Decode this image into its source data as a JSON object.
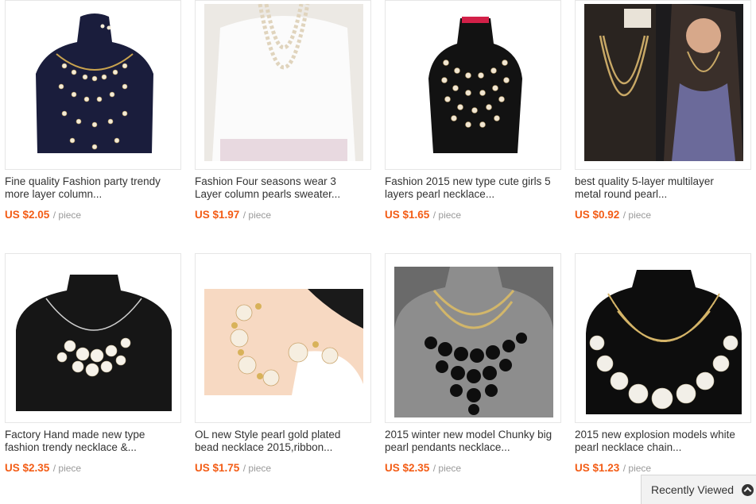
{
  "products": [
    {
      "title_line1": "Fine quality Fashion party trendy",
      "title_line2": "more layer column...",
      "price": "US $2.05",
      "unit": "/ piece",
      "image": "pearl-multilayer-necklace-on-black-bust"
    },
    {
      "title_line1": "Fashion Four seasons wear 3",
      "title_line2": "Layer column pearls sweater...",
      "price": "US $1.97",
      "unit": "/ piece",
      "image": "pearl-necklace-worn-on-white-dress"
    },
    {
      "title_line1": "Fashion 2015 new type cute girls 5",
      "title_line2": "layers pearl necklace...",
      "price": "US $1.65",
      "unit": "/ piece",
      "image": "five-layer-pearl-necklace-on-black-bust"
    },
    {
      "title_line1": "best quality 5-layer multilayer",
      "title_line2": "metal round pearl...",
      "price": "US $0.92",
      "unit": "/ piece",
      "image": "gold-multilayer-chain-on-card-and-model"
    },
    {
      "title_line1": "Factory Hand made new type",
      "title_line2": "fashion trendy necklace &...",
      "price": "US $2.35",
      "unit": "/ piece",
      "image": "pearl-cluster-necklace-on-black-bust"
    },
    {
      "title_line1": "OL new Style pearl gold plated",
      "title_line2": "bead necklace 2015,ribbon...",
      "price": "US $1.75",
      "unit": "/ piece",
      "image": "pearl-gold-bead-necklace-closeup"
    },
    {
      "title_line1": "2015 winter new model Chunky big",
      "title_line2": "pearl pendants necklace...",
      "price": "US $2.35",
      "unit": "/ piece",
      "image": "black-pearl-chunky-necklace-on-grey-bust"
    },
    {
      "title_line1": "2015 new explosion models white",
      "title_line2": "pearl necklace chain...",
      "price": "US $1.23",
      "unit": "/ piece",
      "image": "white-pearl-gold-chain-necklace-on-black-bust"
    }
  ],
  "recently_viewed": {
    "label": "Recently Viewed",
    "icon": "chevron-up-circle-icon"
  },
  "colors": {
    "price": "#f35c15",
    "unit": "#999999",
    "title": "#333333",
    "border": "#e6e6e6"
  }
}
